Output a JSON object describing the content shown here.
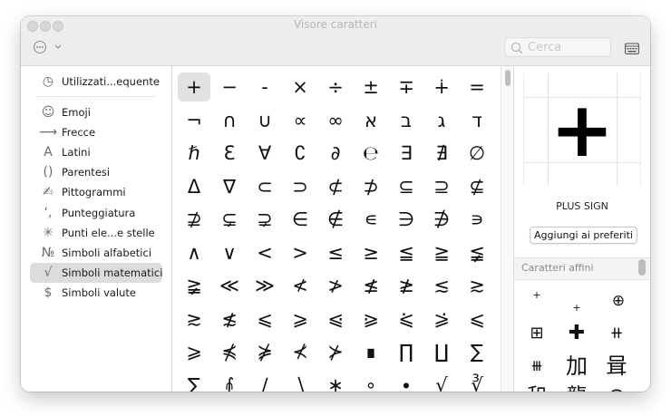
{
  "window": {
    "title": "Visore caratteri"
  },
  "toolbar": {
    "search_placeholder": "Cerca"
  },
  "sidebar": {
    "items": [
      {
        "icon": "◷",
        "label": "Utilizzati...equente",
        "selected": false
      },
      {
        "icon": "☺",
        "label": "Emoji",
        "selected": false
      },
      {
        "icon": "⟶",
        "label": "Frecce",
        "selected": false
      },
      {
        "icon": "A",
        "label": "Latini",
        "selected": false
      },
      {
        "icon": "()",
        "label": "Parentesi",
        "selected": false
      },
      {
        "icon": "✍",
        "label": "Pittogrammi",
        "selected": false
      },
      {
        "icon": "‘,",
        "label": "Punteggiatura",
        "selected": false
      },
      {
        "icon": "✳",
        "label": "Punti ele...e stelle",
        "selected": false
      },
      {
        "icon": "№",
        "label": "Simboli alfabetici",
        "selected": false
      },
      {
        "icon": "√",
        "label": "Simboli matematici",
        "selected": true
      },
      {
        "icon": "$",
        "label": "Simboli valute",
        "selected": false
      }
    ]
  },
  "grid": {
    "selected_index": 0,
    "chars": [
      "+",
      "−",
      "-",
      "×",
      "÷",
      "±",
      "∓",
      "∔",
      "=",
      "¬",
      "∩",
      "∪",
      "∝",
      "∞",
      "א",
      "ב",
      "ג",
      "ד",
      "ℏ",
      "Ɛ",
      "∀",
      "∁",
      "∂",
      "℮",
      "∃",
      "∄",
      "∅",
      "Δ",
      "∇",
      "⊂",
      "⊃",
      "⊄",
      "⊅",
      "⊆",
      "⊇",
      "⊈",
      "⊉",
      "⊊",
      "⊋",
      "∈",
      "∉",
      "∊",
      "∋",
      "∌",
      "∍",
      "∧",
      "∨",
      "<",
      ">",
      "≤",
      "≥",
      "≦",
      "≧",
      "≨",
      "≩",
      "≪",
      "≫",
      "≮",
      "≯",
      "≰",
      "≱",
      "≲",
      "≳",
      "≳",
      "≴",
      "⩽",
      "⩾",
      "⩿",
      "⪀",
      "⪁",
      "⪂",
      "⩽",
      "⩾",
      "⋠",
      "⋡",
      "⊀",
      "⊁",
      "∎",
      "∏",
      "∐",
      "∑",
      "∑",
      "⨙",
      "∕",
      "∖",
      "∗",
      "∘",
      "∙",
      "√",
      "∛"
    ]
  },
  "detail": {
    "preview_char": "+",
    "char_name": "PLUS SIGN",
    "add_favorite_label": "Aggiungi ai preferiti",
    "related_title": "Caratteri affini",
    "related_chars": [
      "+",
      "+",
      "⊕",
      "⊞",
      "✚",
      "⧺",
      "⧻",
      "加",
      "咠",
      "和",
      "龍",
      "⨁"
    ]
  }
}
